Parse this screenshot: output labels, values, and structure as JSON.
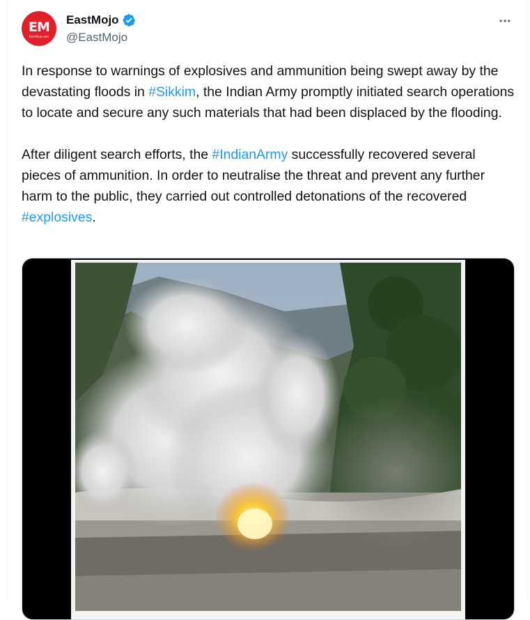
{
  "author": {
    "display_name": "EastMojo",
    "handle": "@EastMojo",
    "avatar_text": "EM",
    "avatar_subtext": "EastMojo.com",
    "verified": true
  },
  "tweet": {
    "paragraph1": {
      "before": "In response to warnings of explosives and ammunition being swept away by the devastating floods in ",
      "hashtag": "#Sikkim",
      "after": ", the Indian Army promptly initiated search operations to locate and secure any such materials that had been displaced by the flooding."
    },
    "paragraph2": {
      "before": "After diligent search efforts, the ",
      "hashtag1": "#IndianArmy",
      "middle": " successfully recovered several pieces of ammunition. In order to neutralise the threat and prevent any further harm to the public, they carried out controlled detonations of the recovered ",
      "hashtag2": "#explosives",
      "after": "."
    }
  },
  "icons": {
    "verified": "verified-badge-icon",
    "more": "more-options-icon"
  },
  "colors": {
    "link": "#1d9bf0",
    "verified": "#1d9bf0",
    "brand": "#e0202a",
    "text": "#0f1419",
    "secondary_text": "#536471"
  }
}
